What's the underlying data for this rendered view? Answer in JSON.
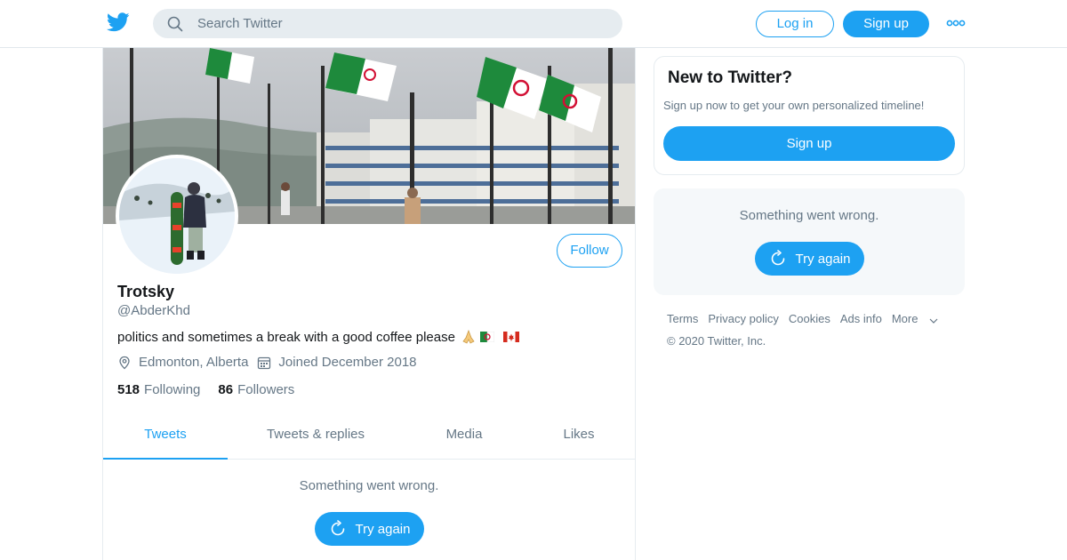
{
  "header": {
    "search_placeholder": "Search Twitter",
    "login_label": "Log in",
    "signup_label": "Sign up"
  },
  "profile": {
    "name": "Trotsky",
    "handle": "@AbderKhd",
    "bio": "politics and sometimes a break with a good coffee please",
    "location": "Edmonton, Alberta",
    "joined": "Joined December 2018",
    "following_count": "518",
    "following_label": "Following",
    "followers_count": "86",
    "followers_label": "Followers",
    "follow_label": "Follow"
  },
  "tabs": [
    {
      "label": "Tweets",
      "active": true
    },
    {
      "label": "Tweets & replies",
      "active": false
    },
    {
      "label": "Media",
      "active": false
    },
    {
      "label": "Likes",
      "active": false
    }
  ],
  "timeline": {
    "error_text": "Something went wrong.",
    "retry_label": "Try again"
  },
  "sidebar": {
    "new_title": "New to Twitter?",
    "new_subtitle": "Sign up now to get your own personalized timeline!",
    "signup_label": "Sign up",
    "error_text": "Something went wrong.",
    "retry_label": "Try again"
  },
  "footer": {
    "links": [
      "Terms",
      "Privacy policy",
      "Cookies",
      "Ads info",
      "More"
    ],
    "copyright": "© 2020 Twitter, Inc."
  },
  "colors": {
    "brand": "#1da1f2",
    "text_secondary": "#657786",
    "border": "#e6ecf0"
  }
}
